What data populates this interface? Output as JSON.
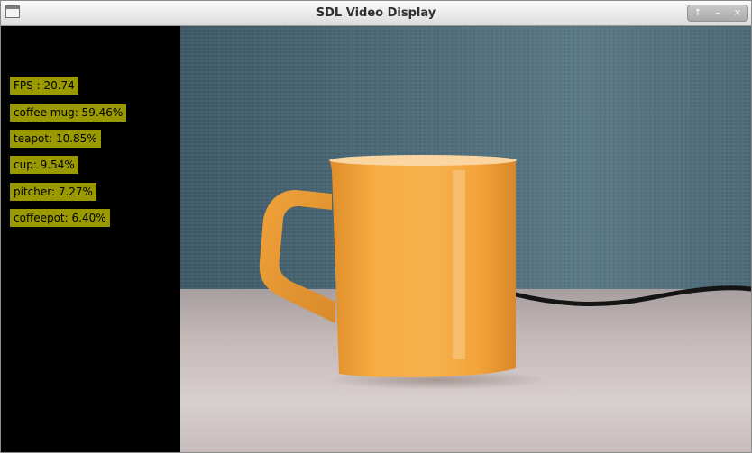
{
  "window": {
    "title": "SDL Video Display",
    "controls": {
      "up": "↑",
      "minimize": "–",
      "close": "×"
    }
  },
  "overlay": {
    "labels": [
      {
        "text": "FPS : 20.74"
      },
      {
        "text": "coffee mug: 59.46%"
      },
      {
        "text": "teapot: 10.85%"
      },
      {
        "text": "cup: 9.54%"
      },
      {
        "text": "pitcher: 7.27%"
      },
      {
        "text": "coffeepot: 6.40%"
      }
    ],
    "label_color": "#9a9a00"
  },
  "colors": {
    "background": "#000000",
    "mug": "#f3a33a",
    "wall": "#4d6b78",
    "desk": "#d3c9c9"
  }
}
